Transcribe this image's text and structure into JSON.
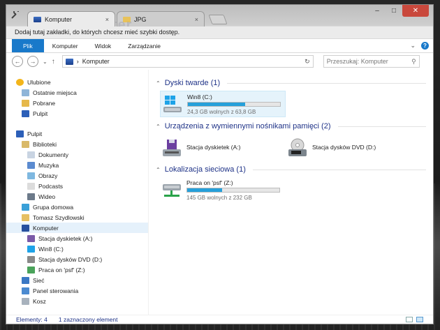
{
  "tabs": [
    {
      "label": "Komputer",
      "icon": "computer-icon"
    },
    {
      "label": "JPG",
      "icon": "folder-icon"
    }
  ],
  "tab_close_glyph": "×",
  "watermark": "Komputer",
  "window_controls": {
    "minimize": "–",
    "maximize": "□",
    "close": "✕"
  },
  "bookmark_bar_text": "Dodaj tutaj zakładki, do których chcesz mieć szybki dostęp.",
  "ribbon": {
    "tabs": [
      "Plik",
      "Komputer",
      "Widok",
      "Zarządzanie"
    ],
    "expand_glyph": "⌄",
    "help_glyph": "?"
  },
  "address": {
    "back_glyph": "←",
    "forward_glyph": "→",
    "history_glyph": "⌄",
    "up_glyph": "↑",
    "path": "Komputer",
    "separator": "›",
    "refresh_glyph": "↻",
    "search_placeholder": "Przeszukaj: Komputer",
    "search_glyph": "⚲"
  },
  "nav": {
    "favorites": [
      {
        "label": "Ulubione",
        "icon": "star-icon",
        "indent": 0
      },
      {
        "label": "Ostatnie miejsca",
        "icon": "recent-places-icon",
        "indent": 1
      },
      {
        "label": "Pobrane",
        "icon": "downloads-icon",
        "indent": 1
      },
      {
        "label": "Pulpit",
        "icon": "desktop-icon",
        "indent": 1
      }
    ],
    "tree": [
      {
        "label": "Pulpit",
        "icon": "desktop-icon",
        "indent": 0
      },
      {
        "label": "Biblioteki",
        "icon": "libraries-icon",
        "indent": 1
      },
      {
        "label": "Dokumenty",
        "icon": "documents-icon",
        "indent": 2
      },
      {
        "label": "Muzyka",
        "icon": "music-icon",
        "indent": 2
      },
      {
        "label": "Obrazy",
        "icon": "pictures-icon",
        "indent": 2
      },
      {
        "label": "Podcasts",
        "icon": "podcasts-icon",
        "indent": 2
      },
      {
        "label": "Wideo",
        "icon": "video-icon",
        "indent": 2
      },
      {
        "label": "Grupa domowa",
        "icon": "homegroup-icon",
        "indent": 1
      },
      {
        "label": "Tomasz Szydlowski",
        "icon": "user-folder-icon",
        "indent": 1
      },
      {
        "label": "Komputer",
        "icon": "computer-icon",
        "indent": 1,
        "selected": true
      },
      {
        "label": "Stacja dyskietek (A:)",
        "icon": "floppy-drive-icon",
        "indent": 2
      },
      {
        "label": "Win8 (C:)",
        "icon": "hard-drive-icon",
        "indent": 2
      },
      {
        "label": "Stacja dysków DVD (D:)",
        "icon": "dvd-drive-icon",
        "indent": 2
      },
      {
        "label": "Praca on 'psf' (Z:)",
        "icon": "network-drive-icon",
        "indent": 2
      },
      {
        "label": "Sieć",
        "icon": "network-icon",
        "indent": 1
      },
      {
        "label": "Panel sterowania",
        "icon": "control-panel-icon",
        "indent": 1
      },
      {
        "label": "Kosz",
        "icon": "recycle-bin-icon",
        "indent": 1
      }
    ]
  },
  "groups": {
    "hard_disks": {
      "title": "Dyski twarde (1)",
      "drives": [
        {
          "name": "Win8 (C:)",
          "free": "24,3 GB wolnych z 63,8 GB",
          "used_fraction": 0.62
        }
      ]
    },
    "removable": {
      "title": "Urządzenia z wymiennymi nośnikami pamięci (2)",
      "drives": [
        {
          "name": "Stacja dyskietek (A:)",
          "icon": "floppy-drive-icon"
        },
        {
          "name": "Stacja dysków DVD (D:)",
          "icon": "dvd-drive-icon"
        }
      ]
    },
    "network": {
      "title": "Lokalizacja sieciowa (1)",
      "drives": [
        {
          "name": "Praca on 'psf' (Z:)",
          "free": "145 GB wolnych z 232 GB",
          "used_fraction": 0.38
        }
      ]
    },
    "collapse_glyph": "⌃"
  },
  "status": {
    "items": "Elementy: 4",
    "selection": "1 zaznaczony element"
  },
  "colors": {
    "accent": "#1979ca",
    "group_header": "#1e3287",
    "bar_fill": "#26a0da",
    "selection": "#e5f3fb"
  }
}
